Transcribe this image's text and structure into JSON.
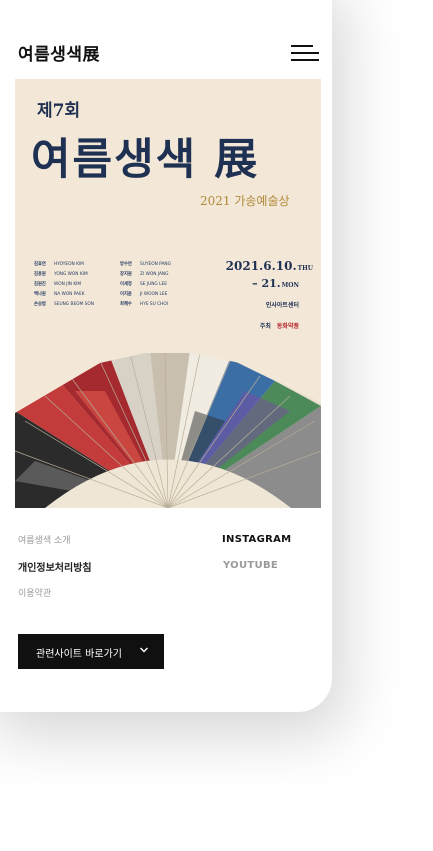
{
  "header": {
    "logo": "여름생색展",
    "menu_icon": "hamburger-menu-icon"
  },
  "poster": {
    "edition": "제7회",
    "title": "여름생색 展",
    "subtitle": "2021 가송예술상",
    "artists_left": [
      {
        "kr": "김효연",
        "en": "HYOYEON KIM"
      },
      {
        "kr": "김용원",
        "en": "YONG WON KIM"
      },
      {
        "kr": "김원진",
        "en": "WON JIN KIM"
      },
      {
        "kr": "백나원",
        "en": "NA WON PAEK"
      },
      {
        "kr": "손승범",
        "en": "SEUNG BEOM SON"
      }
    ],
    "artists_right": [
      {
        "kr": "방수연",
        "en": "SUYEON PANG"
      },
      {
        "kr": "장지원",
        "en": "ZI WON JANG"
      },
      {
        "kr": "이세정",
        "en": "SE JUNG LEE"
      },
      {
        "kr": "이지윤",
        "en": "JI WOON LEE"
      },
      {
        "kr": "최혜수",
        "en": "HYE SU CHOI"
      }
    ],
    "date_start": "2021.6.10.",
    "date_start_day": "THU",
    "date_end": "– 21.",
    "date_end_day": "MON",
    "venue": "인사아트센터",
    "sponsor_label": "주최",
    "sponsor": "동화약품"
  },
  "footer": {
    "intro": "여름생색 소개",
    "privacy": "개인정보처리방침",
    "terms": "이용약관",
    "instagram": "INSTAGRAM",
    "youtube": "YOUTUBE"
  },
  "related_button": {
    "label": "관련사이트 바로가기",
    "icon": "chevron-down-icon"
  },
  "colors": {
    "poster_bg": "#f3e8d8",
    "title_navy": "#1f3153",
    "subtitle_gold": "#b08a3a",
    "button_bg": "#101010"
  }
}
